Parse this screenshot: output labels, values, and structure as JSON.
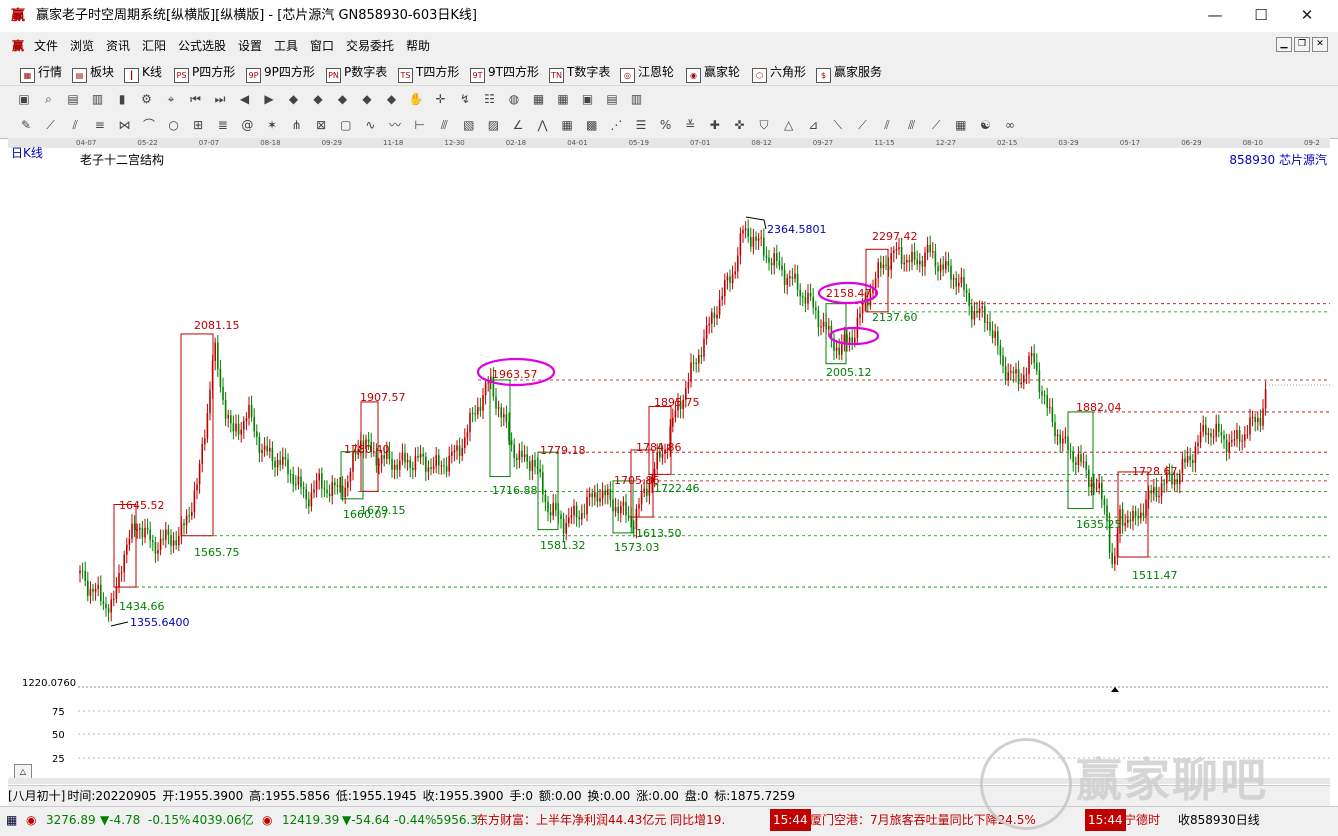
{
  "window": {
    "title": "赢家老子时空周期系统[纵横版][纵横版] - [芯片源汽  GN858930-603日K线]",
    "logo": "赢",
    "controls": [
      "—",
      "☐",
      "✕"
    ]
  },
  "menu": {
    "items": [
      "文件",
      "浏览",
      "资讯",
      "汇阳",
      "公式选股",
      "设置",
      "工具",
      "窗口",
      "交易委托",
      "帮助"
    ],
    "mdi": [
      "▁",
      "❐",
      "✕"
    ]
  },
  "toolbar1": {
    "items": [
      {
        "icon": "grid-icon",
        "glyph": "▦",
        "label": "行情"
      },
      {
        "icon": "sector-icon",
        "glyph": "▤",
        "label": "板块"
      },
      {
        "icon": "kline-icon",
        "glyph": "┃",
        "label": "K线"
      },
      {
        "icon": "p-square-icon",
        "glyph": "PS",
        "label": "P四方形"
      },
      {
        "icon": "9p-square-icon",
        "glyph": "9P",
        "label": "9P四方形"
      },
      {
        "icon": "p-number-icon",
        "glyph": "PN",
        "label": "P数字表"
      },
      {
        "icon": "t-square-icon",
        "glyph": "TS",
        "label": "T四方形"
      },
      {
        "icon": "9t-square-icon",
        "glyph": "9T",
        "label": "9T四方形"
      },
      {
        "icon": "t-number-icon",
        "glyph": "TN",
        "label": "T数字表"
      },
      {
        "icon": "jiangen-wheel-icon",
        "glyph": "◎",
        "label": "江恩轮"
      },
      {
        "icon": "winner-wheel-icon",
        "glyph": "◉",
        "label": "赢家轮"
      },
      {
        "icon": "hexagon-icon",
        "glyph": "⬡",
        "label": "六角形"
      },
      {
        "icon": "dollar-icon",
        "glyph": "$",
        "label": "赢家服务"
      }
    ]
  },
  "toolbar2": {
    "icons": [
      "layout-icon",
      "zoom-icon",
      "doc-icon",
      "bar-chart-icon",
      "candle-icon",
      "settings-icon",
      "cursor-icon",
      "first-icon",
      "last-icon",
      "prev-icon",
      "next-icon",
      "diamond-1-icon",
      "diamond-2-icon",
      "diamond-3-icon",
      "diamond-4-icon",
      "diamond-5-icon",
      "hand-icon",
      "crosshair-icon",
      "trend-icon",
      "chip-icon",
      "globe-icon",
      "calendar-icon",
      "table-icon",
      "save-icon",
      "print-icon",
      "export-icon"
    ],
    "glyphs": [
      "▣",
      "⌕",
      "▤",
      "▥",
      "▮",
      "⚙",
      "⌖",
      "⏮",
      "⏭",
      "◀",
      "▶",
      "◆",
      "◆",
      "◆",
      "◆",
      "◆",
      "✋",
      "✛",
      "↯",
      "☷",
      "◍",
      "▦",
      "▦",
      "▣",
      "▤",
      "▥"
    ]
  },
  "toolbar3": {
    "icons": [
      "pen-icon",
      "line-icon",
      "channel-icon",
      "fib-icon",
      "gann-icon",
      "arc-icon",
      "circle-icon",
      "grid-icon",
      "lines-icon",
      "spiral-icon",
      "star-icon",
      "fan-icon",
      "mesh-icon",
      "box-icon",
      "cycle-icon",
      "wave-icon",
      "ruler-icon",
      "split-icon",
      "square-icon",
      "square2-icon",
      "angle-icon",
      "zigzag-icon",
      "grid2-icon",
      "grid3-icon",
      "slash-icon",
      "text-icon",
      "percent-icon",
      "fib2-icon",
      "cross-icon",
      "compass-icon",
      "shield-icon",
      "pyramid-icon",
      "stairs-icon",
      "line2-icon",
      "line3-icon",
      "line4-icon",
      "line5-icon",
      "line6-icon",
      "table2-icon",
      "taiji-icon",
      "infinity-icon"
    ],
    "glyphs": [
      "✎",
      "⟋",
      "⫽",
      "≡",
      "⋈",
      "⌒",
      "○",
      "⊞",
      "≣",
      "@",
      "✶",
      "⋔",
      "⊠",
      "▢",
      "∿",
      "〰",
      "⊢",
      "⫻",
      "▧",
      "▨",
      "∠",
      "⋀",
      "▦",
      "▩",
      "⋰",
      "☰",
      "%",
      "≚",
      "✚",
      "✜",
      "⛉",
      "△",
      "⊿",
      "⟍",
      "⟋",
      "⫽",
      "⫻",
      "⟋",
      "▦",
      "☯",
      "∞"
    ]
  },
  "chart": {
    "period_label": "日K线",
    "indicator_name": "老子十二宫结构",
    "code_name": "858930  芯片源汽",
    "date_ticks": [
      "04-07",
      "05-22",
      "07-07",
      "08-18",
      "09-29",
      "11-18",
      "12-30",
      "02-18",
      "04-01",
      "05-19",
      "07-01",
      "08-12",
      "09-27",
      "11-15",
      "12-27",
      "02-15",
      "03-29",
      "05-17",
      "06-29",
      "08-10",
      "09-2"
    ],
    "y_axis_label": "1220.0760",
    "sub_ticks": [
      "75",
      "50",
      "25"
    ],
    "scroll_up": "△"
  },
  "chart_data": {
    "type": "candlestick",
    "title": "老子十二宫结构",
    "high_marker": "2364.5801",
    "low_marker": "1355.6400",
    "annotations": [
      {
        "label": "1645.52",
        "color": "#c00000"
      },
      {
        "label": "1434.66",
        "color": "#008000"
      },
      {
        "label": "2081.15",
        "color": "#c00000"
      },
      {
        "label": "1565.75",
        "color": "#008000"
      },
      {
        "label": "1907.57",
        "color": "#c00000"
      },
      {
        "label": "1780.40",
        "color": "#c00000"
      },
      {
        "label": "1660.07",
        "color": "#008000"
      },
      {
        "label": "1679.15",
        "color": "#008000"
      },
      {
        "label": "1963.57",
        "color": "#c00000"
      },
      {
        "label": "1716.88",
        "color": "#008000"
      },
      {
        "label": "1779.18",
        "color": "#c00000"
      },
      {
        "label": "1581.32",
        "color": "#008000"
      },
      {
        "label": "1705.86",
        "color": "#c00000"
      },
      {
        "label": "1573.03",
        "color": "#008000"
      },
      {
        "label": "1784.86",
        "color": "#c00000"
      },
      {
        "label": "1722.46",
        "color": "#008000"
      },
      {
        "label": "1613.50",
        "color": "#008000"
      },
      {
        "label": "1895.75",
        "color": "#c00000"
      },
      {
        "label": "2158.47",
        "color": "#c00000"
      },
      {
        "label": "2137.60",
        "color": "#008000"
      },
      {
        "label": "2005.12",
        "color": "#008000"
      },
      {
        "label": "2297.42",
        "color": "#c00000"
      },
      {
        "label": "1882.04",
        "color": "#c00000"
      },
      {
        "label": "1635.25",
        "color": "#008000"
      },
      {
        "label": "1728.67",
        "color": "#c00000"
      },
      {
        "label": "1511.47",
        "color": "#008000"
      }
    ],
    "ellipse_highlights": [
      "1963.57",
      "2158.47",
      "2137.60"
    ],
    "colors": {
      "up": "#c00000",
      "down": "#008000",
      "marker": "#0000c0",
      "ellipse": "#e000e0"
    }
  },
  "infobar": {
    "lunar": "[八月初十]",
    "time": "时间:20220905",
    "open": "开:1955.3900",
    "high": "高:1955.5856",
    "low": "低:1955.1945",
    "close": "收:1955.3900",
    "hand": "手:0",
    "amount": "额:0.00",
    "turnover": "换:0.00",
    "change": "涨:0.00",
    "pan": "盘:0",
    "mark": "标:1875.7259"
  },
  "status": {
    "index1": "3276.89",
    "index1_change": "▼-4.78",
    "index1_pct": "-0.15%",
    "index1_amt": "4039.06亿",
    "index2": "12419.39",
    "index2_change": "▼-54.64",
    "index2_pct": "-0.44%",
    "index2_amt": "5956.3",
    "news1": "东方财富：上半年净利润44.43亿元 同比增19.",
    "news_time1": "15:44",
    "news2": "厦门空港：7月旅客吞吐量同比下降24.5%",
    "news_time2": "15:44",
    "news3": "宁德时",
    "collect": "收858930日线"
  },
  "watermark": {
    "text": "赢家聊吧"
  }
}
